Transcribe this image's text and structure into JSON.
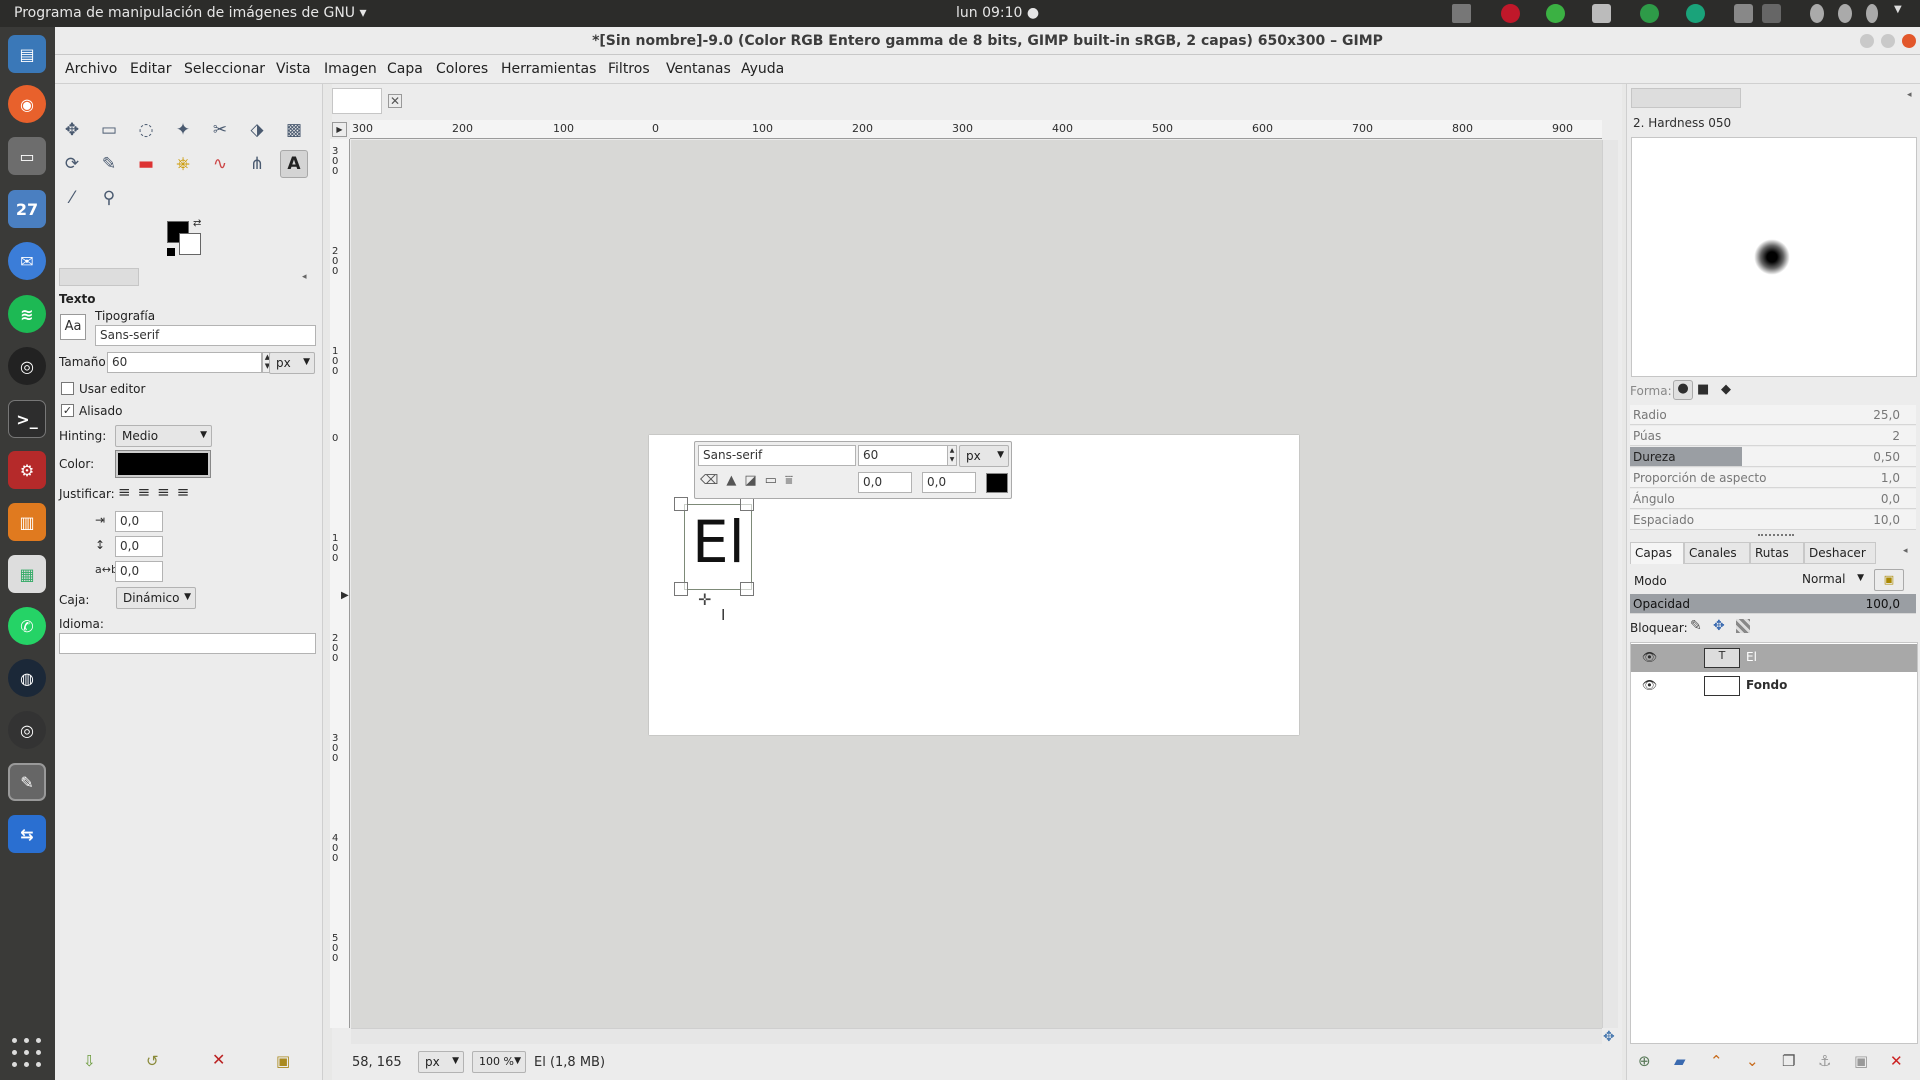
{
  "topbar": {
    "app_menu": "Programa de manipulación de imágenes de GNU ▾",
    "clock": "lun 09:10 ●"
  },
  "window": {
    "title": "*[Sin nombre]-9.0 (Color RGB Entero gamma de 8 bits, GIMP built-in sRGB, 2 capas) 650x300 – GIMP"
  },
  "dock": {
    "calendar_day": "27"
  },
  "menu": [
    "Archivo",
    "Editar",
    "Seleccionar",
    "Vista",
    "Imagen",
    "Capa",
    "Colores",
    "Herramientas",
    "Filtros",
    "Ventanas",
    "Ayuda"
  ],
  "tool_options": {
    "title": "Texto",
    "font_label": "Tipografía",
    "font_icon": "Aa",
    "font_value": "Sans-serif",
    "size_label": "Tamaño:",
    "size_value": "60",
    "size_unit": "px",
    "use_editor_label": "Usar editor",
    "use_editor_checked": false,
    "antialias_label": "Alisado",
    "antialias_checked": true,
    "hinting_label": "Hinting:",
    "hinting_value": "Medio",
    "color_label": "Color:",
    "color_value": "#000000",
    "justify_label": "Justificar:",
    "indent_value": "0,0",
    "line_spacing_value": "0,0",
    "letter_spacing_value": "0,0",
    "box_label": "Caja:",
    "box_value": "Dinámico",
    "language_label": "Idioma:",
    "language_value": ""
  },
  "canvas": {
    "ruler_labels": [
      "300",
      "200",
      "100",
      "0",
      "100",
      "200",
      "300",
      "400",
      "500",
      "600",
      "700",
      "800",
      "900"
    ],
    "vruler_labels": [
      "3 0 0",
      "2 0 0",
      "1 0 0",
      "0",
      "1 0 0",
      "2 0 0",
      "3 0 0",
      "4 0 0",
      "5 0 0"
    ],
    "text_content": "El",
    "text_toolbar": {
      "font": "Sans-serif",
      "size": "60",
      "unit": "px",
      "baseline": "0,0",
      "kerning": "0,0"
    }
  },
  "status": {
    "coords": "58, 165",
    "unit": "px",
    "zoom": "100 %",
    "info": "El (1,8 MB)"
  },
  "brushes": {
    "selected": "2. Hardness 050",
    "shape_label": "Forma:",
    "params": [
      {
        "name": "Radio",
        "value": "25,0",
        "fraction": 0.0
      },
      {
        "name": "Púas",
        "value": "2",
        "fraction": 0.0
      },
      {
        "name": "Dureza",
        "value": "0,50",
        "fraction": 0.39
      },
      {
        "name": "Proporción de aspecto",
        "value": "1,0",
        "fraction": 0.0
      },
      {
        "name": "Ángulo",
        "value": "0,0",
        "fraction": 0.0
      },
      {
        "name": "Espaciado",
        "value": "10,0",
        "fraction": 0.0
      }
    ]
  },
  "layers_panel": {
    "tabs": [
      "Capas",
      "Canales",
      "Rutas",
      "Deshacer"
    ],
    "mode_label": "Modo",
    "mode_value": "Normal",
    "opacity_label": "Opacidad",
    "opacity_value": "100,0",
    "lock_label": "Bloquear:",
    "layers": [
      "El",
      "Fondo"
    ]
  }
}
